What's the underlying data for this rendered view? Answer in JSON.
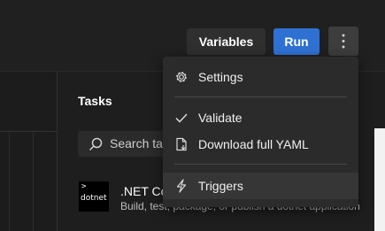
{
  "toolbar": {
    "variables_label": "Variables",
    "run_label": "Run",
    "more_icon": "more-vertical-icon"
  },
  "menu": {
    "items": [
      {
        "label": "Settings",
        "icon": "gear-icon"
      },
      {
        "label": "Validate",
        "icon": "checkmark-icon"
      },
      {
        "label": "Download full YAML",
        "icon": "download-file-icon"
      },
      {
        "label": "Triggers",
        "icon": "lightning-icon"
      }
    ]
  },
  "tasks": {
    "title": "Tasks",
    "search_placeholder": "Search tasks",
    "items": [
      {
        "logo_text": "dotnet",
        "logo_symbol": ">",
        "name": ".NET Core",
        "description": "Build, test, package, or publish a dotnet application"
      }
    ]
  },
  "colors": {
    "background": "#1e1e1e",
    "run_button": "#2f71d3",
    "menu_background": "#2b2b2b"
  }
}
